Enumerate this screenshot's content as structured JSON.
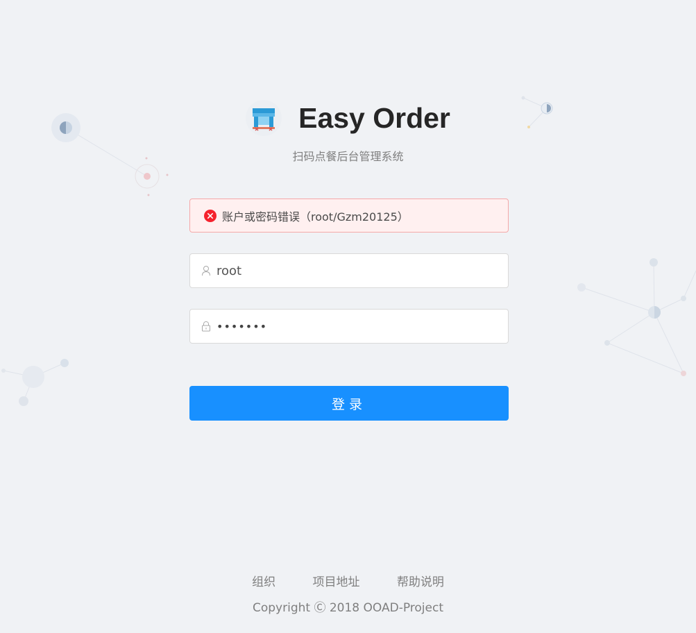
{
  "app": {
    "title": "Easy Order",
    "subtitle": "扫码点餐后台管理系统"
  },
  "alert": {
    "message": "账户或密码错误（root/Gzm20125）",
    "icon": "close-circle-icon",
    "color": "#f5222d"
  },
  "username": {
    "value": "root",
    "icon": "user-icon"
  },
  "password": {
    "value": "•••••••",
    "icon": "lock-icon"
  },
  "login_button": {
    "label": "登录",
    "color": "#1890ff"
  },
  "footer": {
    "links": [
      "组织",
      "项目地址",
      "帮助说明"
    ],
    "copyright": "Copyright Ⓒ 2018 OOAD-Project"
  }
}
